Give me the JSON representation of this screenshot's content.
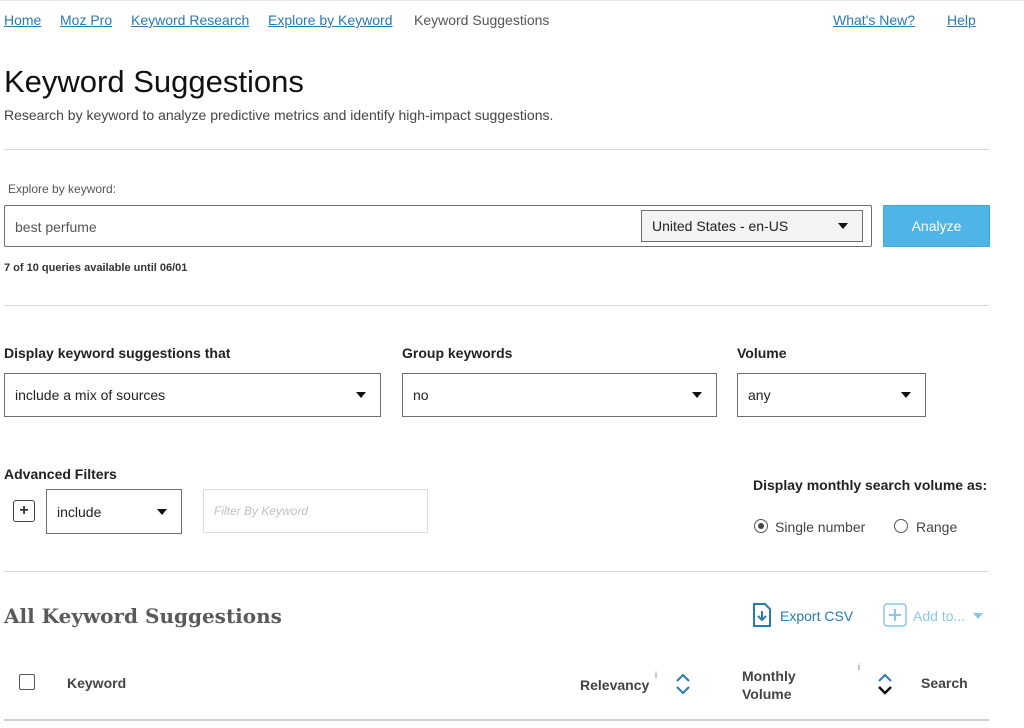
{
  "breadcrumb": {
    "items": [
      "Home",
      "Moz Pro",
      "Keyword Research",
      "Explore by Keyword"
    ],
    "current": "Keyword Suggestions",
    "whats_new": "What's New?",
    "help": "Help"
  },
  "header": {
    "title": "Keyword Suggestions",
    "subtitle": "Research by keyword to analyze predictive metrics and identify high-impact suggestions."
  },
  "search": {
    "label": "Explore by keyword:",
    "value": "best perfume",
    "locale": "United States - en-US",
    "analyze_label": "Analyze",
    "quota": "7 of 10 queries available until 06/01"
  },
  "options": {
    "display_label": "Display keyword suggestions that",
    "display_value": "include a mix of sources",
    "group_label": "Group keywords",
    "group_value": "no",
    "volume_label": "Volume",
    "volume_value": "any"
  },
  "advanced": {
    "label": "Advanced Filters",
    "include_value": "include",
    "filter_placeholder": "Filter By Keyword",
    "monthly_label": "Display monthly search volume as:",
    "single_label": "Single number",
    "range_label": "Range",
    "selected": "Single number"
  },
  "results": {
    "title": "All Keyword Suggestions",
    "export_label": "Export CSV",
    "addto_label": "Add to...",
    "columns": {
      "keyword": "Keyword",
      "relevancy": "Relevancy",
      "monthly_volume": "Monthly Volume",
      "search": "Search"
    },
    "info_glyph": "i"
  },
  "colors": {
    "link": "#2a7ab0",
    "primary_button": "#4fb5e6"
  }
}
